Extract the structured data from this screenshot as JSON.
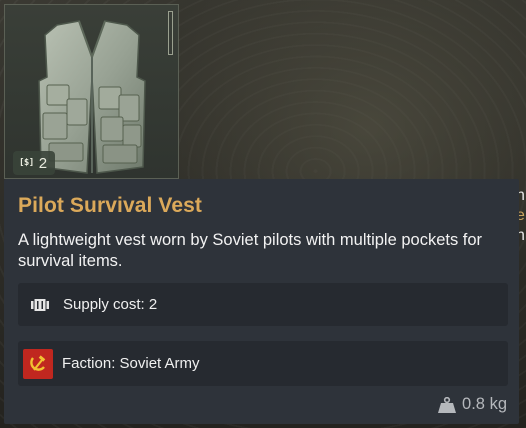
{
  "item": {
    "name": "Pilot Survival Vest",
    "description": "A lightweight vest worn by Soviet pilots with multiple pockets for survival items.",
    "slot_cost_icon": "[$]",
    "slot_cost_value": "2",
    "supply_cost_label": "Supply cost: 2",
    "faction_label": "Faction: Soviet Army",
    "weight_label": "0.8 kg"
  },
  "icons": {
    "supply": "supply-crate-icon",
    "faction": "hammer-sickle-flag-icon",
    "weight": "weight-icon",
    "item": "vest-icon"
  },
  "colors": {
    "title": "#dba95a",
    "tooltip_bg": "#2e333a",
    "row_bg": "#262a30",
    "soviet_red": "#c0271f"
  }
}
